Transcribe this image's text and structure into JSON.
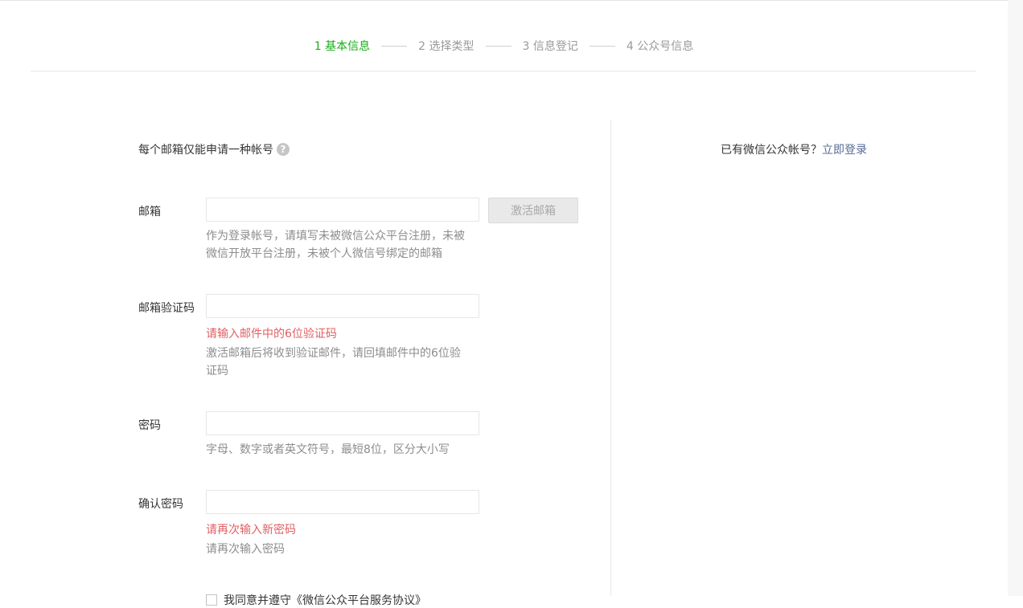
{
  "steps": [
    {
      "label": "1 基本信息",
      "active": true
    },
    {
      "label": "2 选择类型",
      "active": false
    },
    {
      "label": "3 信息登记",
      "active": false
    },
    {
      "label": "4 公众号信息",
      "active": false
    }
  ],
  "intro": {
    "text": "每个邮箱仅能申请一种帐号",
    "help_icon": "?"
  },
  "form": {
    "email": {
      "label": "邮箱",
      "value": "",
      "button": "激活邮箱",
      "tip": "作为登录帐号，请填写未被微信公众平台注册，未被微信开放平台注册，未被个人微信号绑定的邮箱"
    },
    "code": {
      "label": "邮箱验证码",
      "value": "",
      "error": "请输入邮件中的6位验证码",
      "tip": "激活邮箱后将收到验证邮件，请回填邮件中的6位验证码"
    },
    "password": {
      "label": "密码",
      "value": "",
      "tip": "字母、数字或者英文符号，最短8位，区分大小写"
    },
    "confirm": {
      "label": "确认密码",
      "value": "",
      "error": "请再次输入新密码",
      "tip": "请再次输入密码"
    },
    "agreement": {
      "text": "我同意并遵守《微信公众平台服务协议》"
    }
  },
  "side": {
    "prompt": "已有微信公众帐号？",
    "link": "立即登录"
  },
  "colors": {
    "active_step": "#1aad19",
    "error": "#e15f63",
    "link": "#576b95"
  }
}
